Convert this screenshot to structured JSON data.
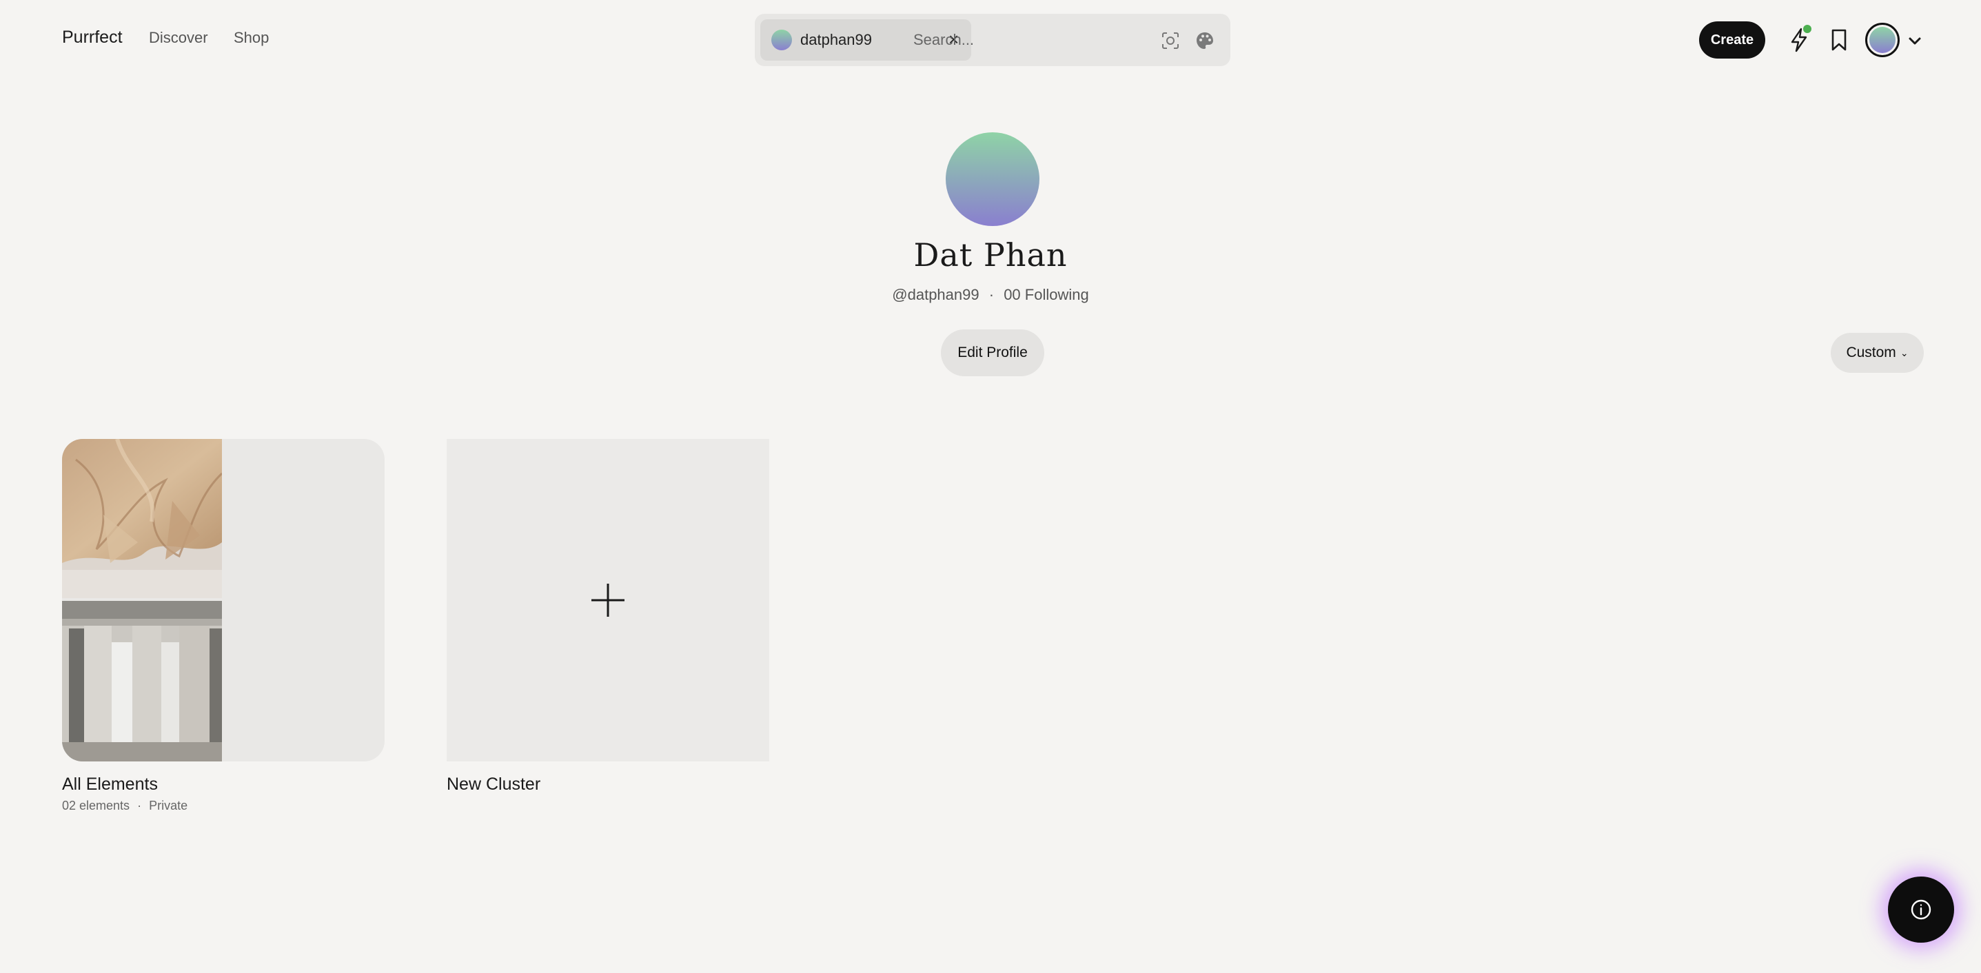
{
  "header": {
    "logo": "Purrfect",
    "nav": [
      {
        "label": "Discover"
      },
      {
        "label": "Shop"
      }
    ],
    "search": {
      "chip_label": "datphan99",
      "placeholder": "Search..."
    },
    "create_label": "Create",
    "icons": [
      "bolt-icon",
      "bookmark-icon",
      "avatar",
      "chevron-down-icon"
    ],
    "notification_color": "#4caf50"
  },
  "profile": {
    "name": "Dat Phan",
    "handle": "@datphan99",
    "separator": "·",
    "following": "00 Following",
    "edit_label": "Edit Profile",
    "sort_label": "Custom",
    "avatar_gradient": [
      "#8fd3a6",
      "#8a7fcf"
    ]
  },
  "clusters": [
    {
      "title": "All Elements",
      "count": "02 elements",
      "separator": "·",
      "visibility": "Private"
    },
    {
      "title": "New Cluster"
    }
  ],
  "fab_icon": "info-icon"
}
